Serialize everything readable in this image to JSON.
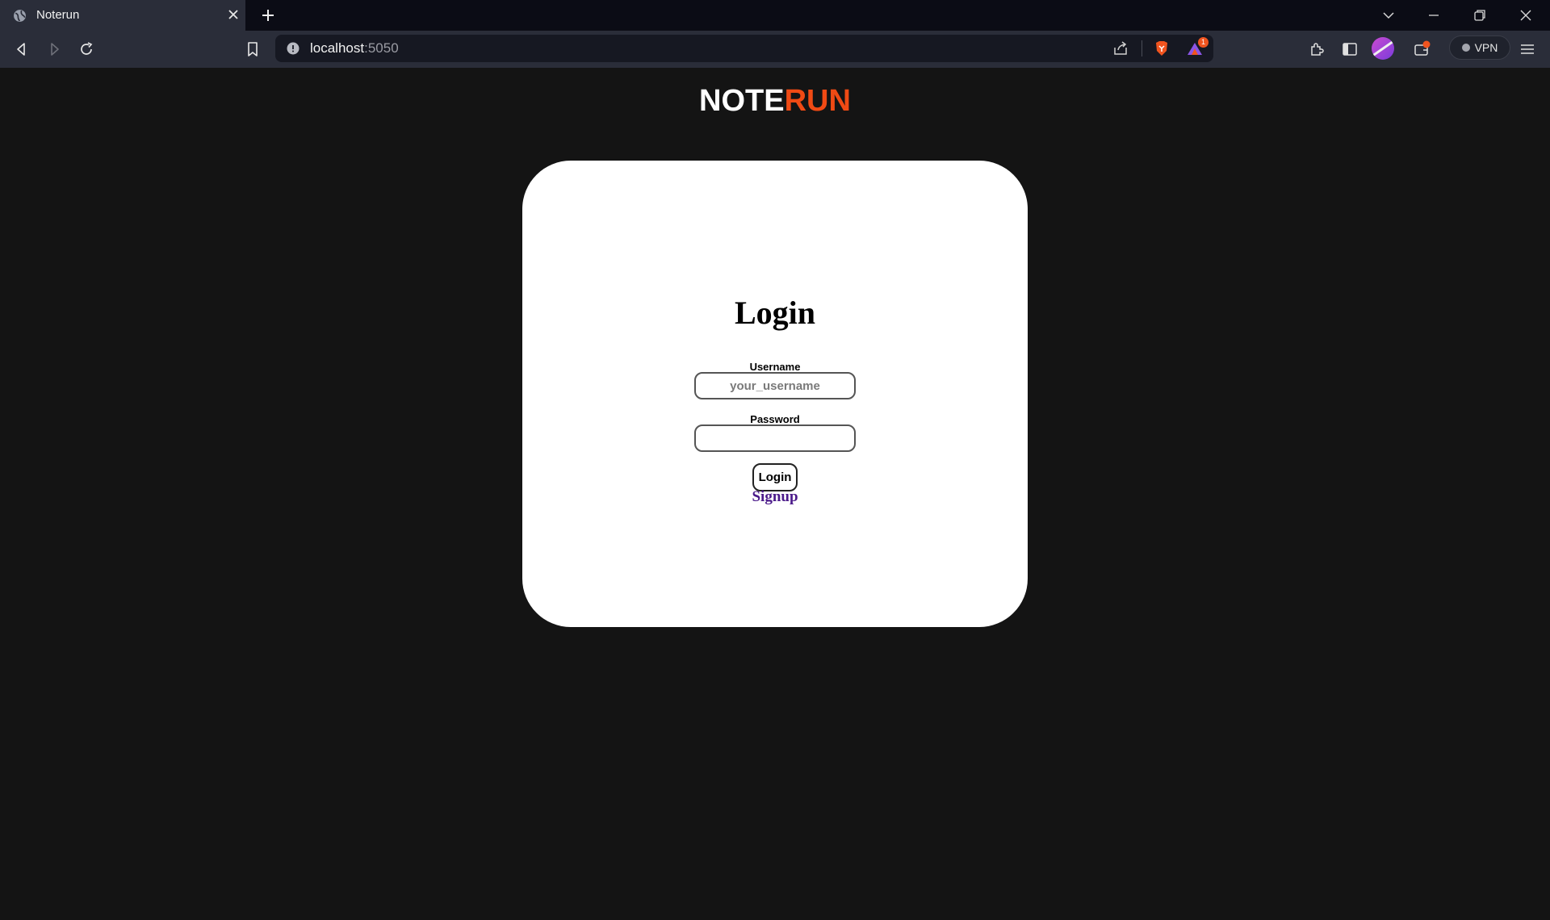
{
  "browser": {
    "tab_title": "Noterun",
    "url_host": "localhost",
    "url_port": ":5050",
    "vpn_label": "VPN",
    "notification_badge": "1",
    "accent": "#f04a14"
  },
  "page": {
    "logo_part1": "NOTE",
    "logo_part2": "RUN",
    "title": "Login",
    "username_label": "Username",
    "username_placeholder": "your_username",
    "username_value": "",
    "password_label": "Password",
    "password_value": "",
    "login_button": "Login",
    "signup_link": "Signup",
    "colors": {
      "background": "#141414",
      "card": "#ffffff",
      "logo_accent": "#f04a14",
      "link": "#4b1a8a"
    }
  },
  "icons": {
    "tab": [
      "globe-icon",
      "close-icon",
      "plus-icon"
    ],
    "window": [
      "chevron-down-icon",
      "minimize-icon",
      "restore-icon",
      "close-icon"
    ],
    "toolbar": [
      "back-icon",
      "forward-icon",
      "reload-icon",
      "bookmark-icon",
      "info-icon",
      "share-icon",
      "brave-shield-icon",
      "brave-rewards-icon",
      "extensions-icon",
      "sidebar-icon",
      "profile-avatar",
      "wallet-icon",
      "vpn-icon",
      "menu-icon"
    ]
  }
}
